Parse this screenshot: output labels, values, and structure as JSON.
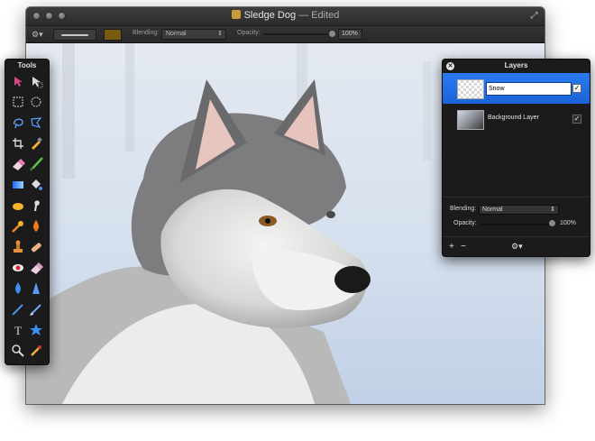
{
  "window": {
    "title": "Sledge Dog",
    "title_separator": " — ",
    "status": "Edited",
    "fullscreen_icon": "fullscreen-arrows-icon",
    "traffic_light_color": "#7a7a7a"
  },
  "options_bar": {
    "gear_icon": "gear-icon",
    "brush_color": "#7a5a10",
    "blending_label": "Blending:",
    "blending_value": "Normal",
    "opacity_label": "Opacity:",
    "opacity_value": "100%",
    "opacity_fraction": 1.0
  },
  "tools_palette": {
    "title": "Tools",
    "tools": [
      "arrange-icon",
      "selection-move-icon",
      "rect-select-icon",
      "ellipse-select-icon",
      "lasso-icon",
      "polygon-lasso-icon",
      "crop-icon",
      "eyedropper-icon",
      "eraser-icon",
      "brush-icon",
      "gradient-icon",
      "paint-bucket-icon",
      "sponge-icon",
      "smudge-icon",
      "burn-icon",
      "dodge-icon",
      "clone-stamp-icon",
      "heal-icon",
      "red-eye-icon",
      "smudge-eraser-icon",
      "blur-icon",
      "sharpen-icon",
      "pen-icon",
      "vector-pen-icon",
      "text-icon",
      "shape-icon",
      "zoom-icon",
      "color-picker-icon"
    ]
  },
  "layers_palette": {
    "title": "Layers",
    "layers": [
      {
        "name": "Snow",
        "visible": true,
        "selected": true
      },
      {
        "name": "Background Layer",
        "visible": true,
        "selected": false
      }
    ],
    "blending_label": "Blending:",
    "blending_value": "Normal",
    "opacity_label": "Opacity:",
    "opacity_value": "100%",
    "opacity_fraction": 1.0,
    "footer": {
      "add": "+",
      "remove": "−",
      "gear_icon": "gear-icon"
    }
  },
  "canvas": {
    "image_subject": "sledge-dog-photo"
  }
}
